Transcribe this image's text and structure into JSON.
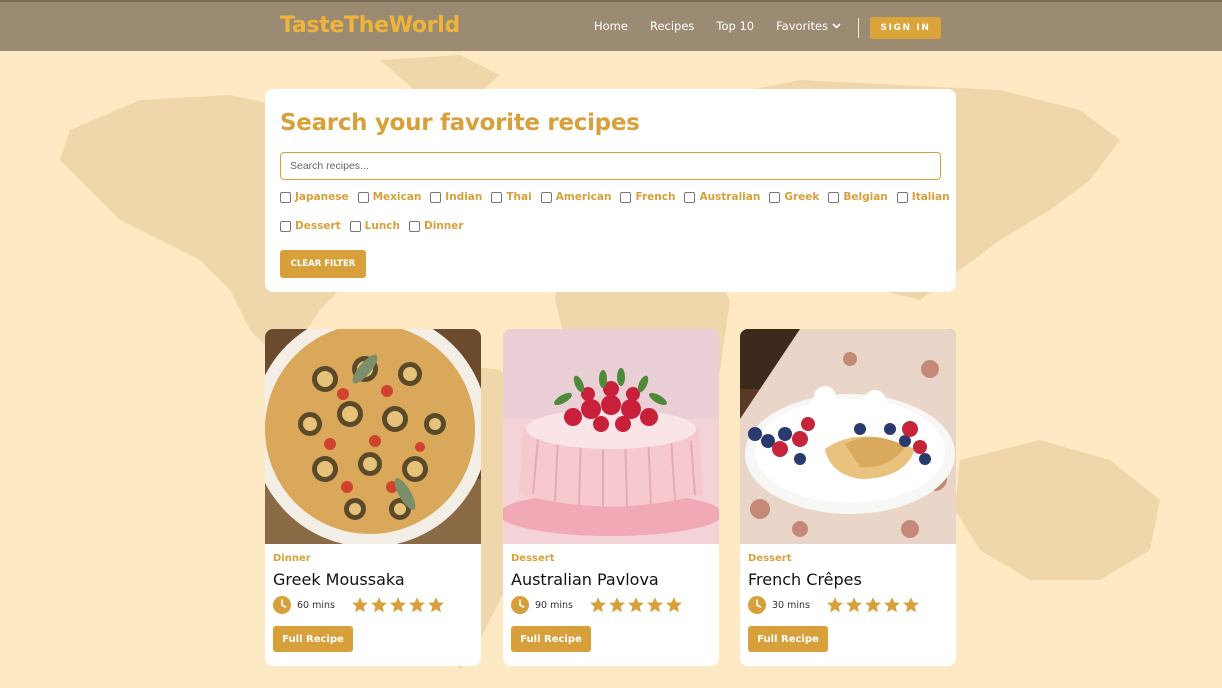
{
  "header": {
    "logo": "TasteTheWorld",
    "nav": [
      {
        "label": "Home"
      },
      {
        "label": "Recipes"
      },
      {
        "label": "Top 10"
      },
      {
        "label": "Favorites"
      }
    ],
    "signin_label": "SIGN IN"
  },
  "search": {
    "title": "Search your favorite recipes",
    "placeholder": "Search recipes...",
    "filters_row1": [
      "Japanese",
      "Mexican",
      "Indian",
      "Thai",
      "American",
      "French",
      "Australian",
      "Greek",
      "Belgian",
      "Italian"
    ],
    "filters_row2": [
      "Dessert",
      "Lunch",
      "Dinner"
    ],
    "clear_label": "CLEAR FILTER"
  },
  "cards": [
    {
      "category": "Dinner",
      "title": "Greek Moussaka",
      "time": "60 mins",
      "rating": 5,
      "button": "Full Recipe",
      "image": "moussaka-photo"
    },
    {
      "category": "Dessert",
      "title": "Australian Pavlova",
      "time": "90 mins",
      "rating": 5,
      "button": "Full Recipe",
      "image": "pavlova-photo"
    },
    {
      "category": "Dessert",
      "title": "French Crêpes",
      "time": "30 mins",
      "rating": 5,
      "button": "Full Recipe",
      "image": "crepes-photo"
    }
  ],
  "colors": {
    "accent": "#d8a03b",
    "header_bg": "#9b8b72",
    "page_bg": "#fde9c4",
    "logo": "#f1b43a"
  }
}
